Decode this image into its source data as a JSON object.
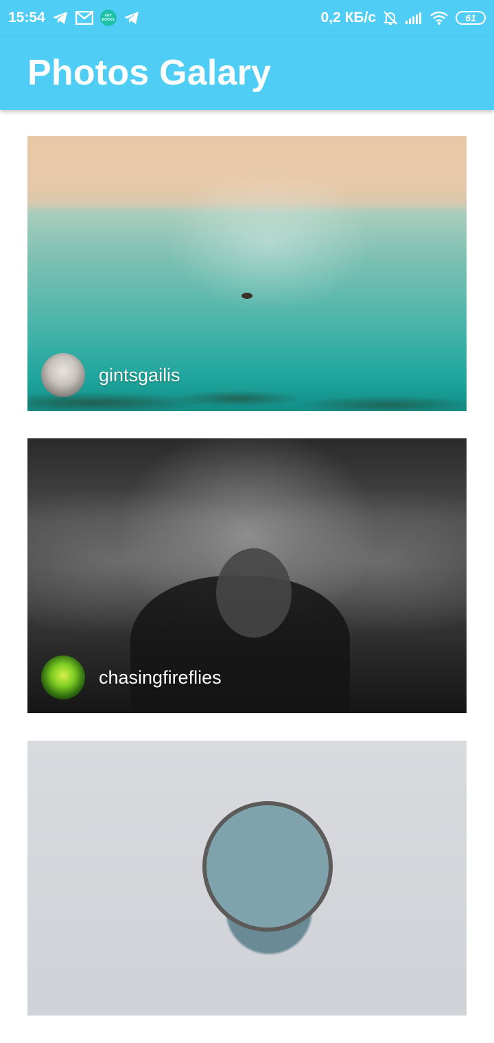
{
  "status_bar": {
    "time": "15:54",
    "left_icons": [
      "telegram-icon",
      "gmail-icon",
      "anybooks-icon",
      "telegram-icon"
    ],
    "anybooks_text": "ANY BOOKS",
    "network_speed": "0,2 КБ/с",
    "right_icons": [
      "bell-off-icon",
      "signal-icon",
      "wifi-icon",
      "battery-icon"
    ],
    "battery_level": "61"
  },
  "app_bar": {
    "title": "Photos Galary",
    "color": "#4fcdf5"
  },
  "photos": [
    {
      "author": "gintsgailis",
      "subject": "aerial beach with swimmer"
    },
    {
      "author": "chasingfireflies",
      "subject": "underwater woman black and white"
    },
    {
      "author": "",
      "subject": "aerial round sofa on sand"
    }
  ]
}
